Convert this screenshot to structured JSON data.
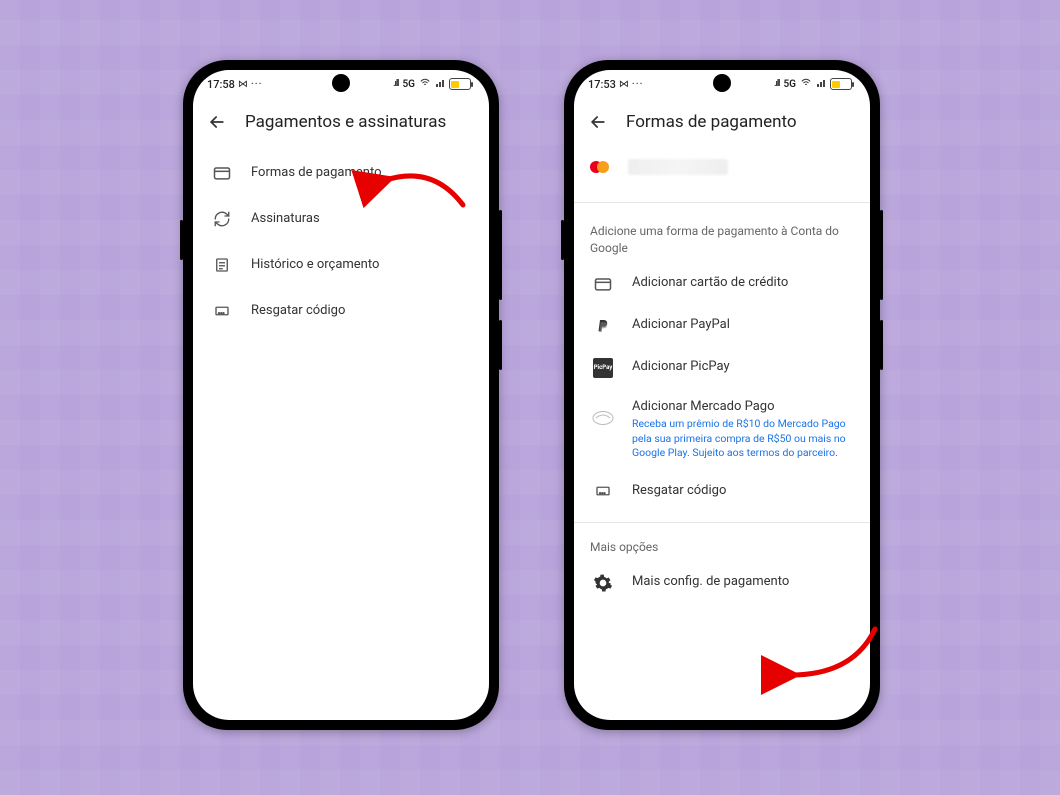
{
  "status": {
    "time_left": "17:58",
    "time_right": "17:53",
    "network": "5G",
    "bt_icon": "⋈",
    "dots": "···",
    "signal": ".ıll",
    "wifi": ""
  },
  "phone1": {
    "title": "Pagamentos e assinaturas",
    "items": [
      {
        "icon": "card",
        "label": "Formas de pagamento"
      },
      {
        "icon": "refresh",
        "label": "Assinaturas"
      },
      {
        "icon": "doc",
        "label": "Histórico e orçamento"
      },
      {
        "icon": "code",
        "label": "Resgatar código"
      }
    ]
  },
  "phone2": {
    "title": "Formas de pagamento",
    "add_header": "Adicione uma forma de pagamento à Conta do Google",
    "more_header": "Mais opções",
    "add_items": [
      {
        "icon": "card",
        "label": "Adicionar cartão de crédito"
      },
      {
        "icon": "paypal",
        "label": "Adicionar PayPal"
      },
      {
        "icon": "picpay",
        "label": "Adicionar PicPay"
      },
      {
        "icon": "mpago",
        "label": "Adicionar Mercado Pago",
        "sub": "Receba um prêmio de R$10 do Mercado Pago pela sua primeira compra de R$50 ou mais no Google Play. Sujeito aos termos do parceiro."
      },
      {
        "icon": "code",
        "label": "Resgatar código"
      }
    ],
    "more_item": {
      "icon": "gear",
      "label": "Mais config. de pagamento"
    }
  }
}
